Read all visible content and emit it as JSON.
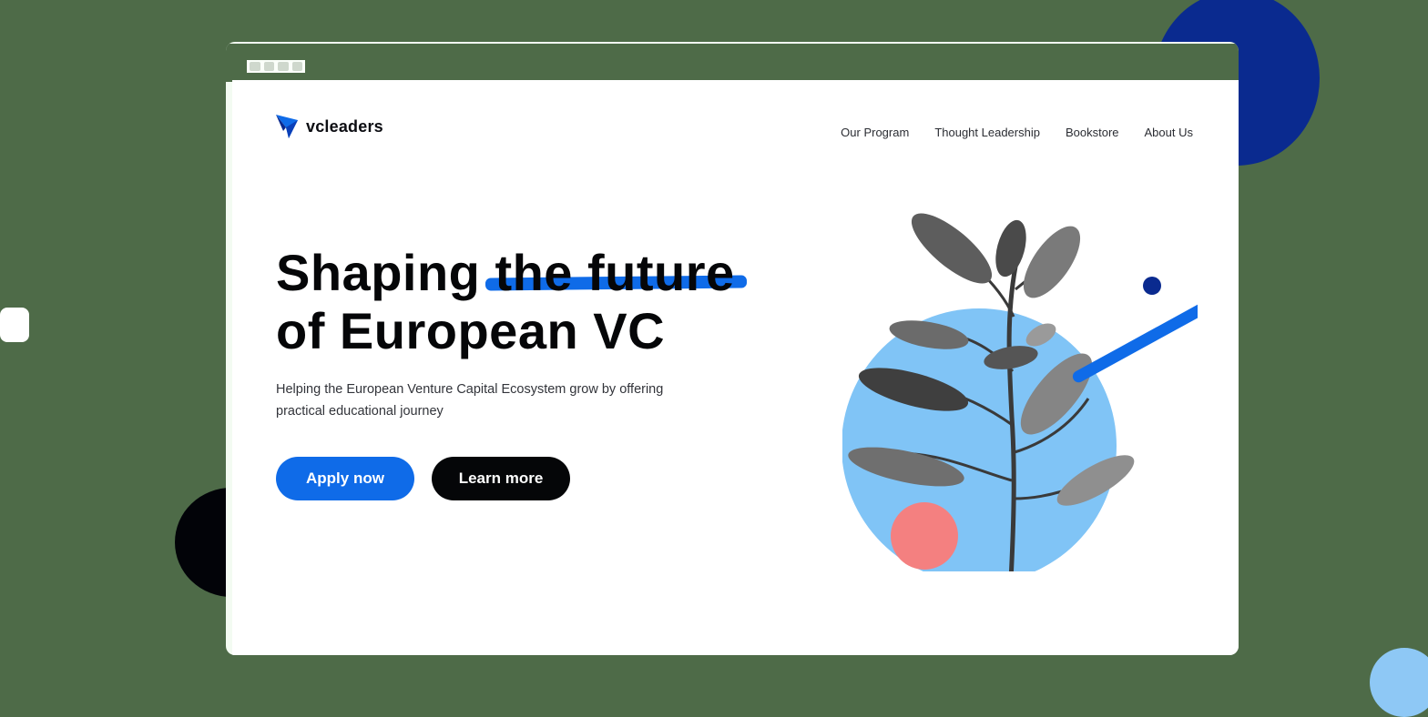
{
  "colors": {
    "accent": "#0f6be8",
    "dark": "#050608",
    "navy": "#0a2a8f",
    "light_blue": "#80c4f6",
    "coral": "#f48080",
    "backdrop": "#4e6b48"
  },
  "logo": {
    "icon": "paper-plane-icon",
    "text": "vcleaders"
  },
  "nav": {
    "items": [
      {
        "label": "Our Program"
      },
      {
        "label": "Thought Leadership"
      },
      {
        "label": "Bookstore"
      },
      {
        "label": "About Us"
      }
    ]
  },
  "hero": {
    "title_part1": "Shaping ",
    "title_highlight": "the future",
    "title_line2": "of European VC",
    "subtitle": "Helping the European Venture Capital Ecosystem grow by offering practical educational journey",
    "primary_button": "Apply now",
    "secondary_button": "Learn more"
  },
  "illustration": {
    "subject": "plant-icon"
  }
}
